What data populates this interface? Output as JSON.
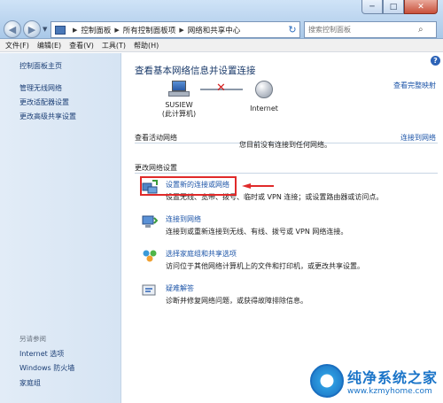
{
  "window": {
    "minimize_glyph": "─",
    "maximize_glyph": "□",
    "close_glyph": "✕"
  },
  "address": {
    "crumbs": [
      "控制面板",
      "所有控制面板项",
      "网络和共享中心"
    ],
    "refresh_glyph": "↻"
  },
  "search": {
    "placeholder": "搜索控制面板"
  },
  "menu": [
    "文件(F)",
    "编辑(E)",
    "查看(V)",
    "工具(T)",
    "帮助(H)"
  ],
  "sidebar": {
    "home": "控制面板主页",
    "links": [
      "管理无线网络",
      "更改适配器设置",
      "更改高级共享设置"
    ],
    "see_also_header": "另请参阅",
    "see_also": [
      "Internet 选项",
      "Windows 防火墙",
      "家庭组"
    ]
  },
  "main": {
    "title": "查看基本网络信息并设置连接",
    "full_map": "查看完整映射",
    "computer_name": "SUSIEW",
    "computer_sub": "(此计算机)",
    "internet_label": "Internet",
    "active_header": "查看活动网络",
    "connect_or_disconnect": "连接到网络",
    "not_connected": "您目前没有连接到任何网络。",
    "change_header": "更改网络设置",
    "tasks": [
      {
        "icon": "network-setup-icon",
        "link": "设置新的连接或网络",
        "desc": "设置无线、宽带、拨号、临时或 VPN 连接；或设置路由器或访问点。"
      },
      {
        "icon": "connect-network-icon",
        "link": "连接到网络",
        "desc": "连接到或重新连接到无线、有线、拨号或 VPN 网络连接。"
      },
      {
        "icon": "homegroup-icon",
        "link": "选择家庭组和共享选项",
        "desc": "访问位于其他网络计算机上的文件和打印机，或更改共享设置。"
      },
      {
        "icon": "troubleshoot-icon",
        "link": "疑难解答",
        "desc": "诊断并修复网络问题，或获得故障排除信息。"
      }
    ]
  },
  "watermark": {
    "title": "纯净系统之家",
    "url": "www.kzmyhome.com"
  },
  "colors": {
    "link": "#1d55a8",
    "highlight": "#e02a2a",
    "title": "#1a3a6a"
  }
}
